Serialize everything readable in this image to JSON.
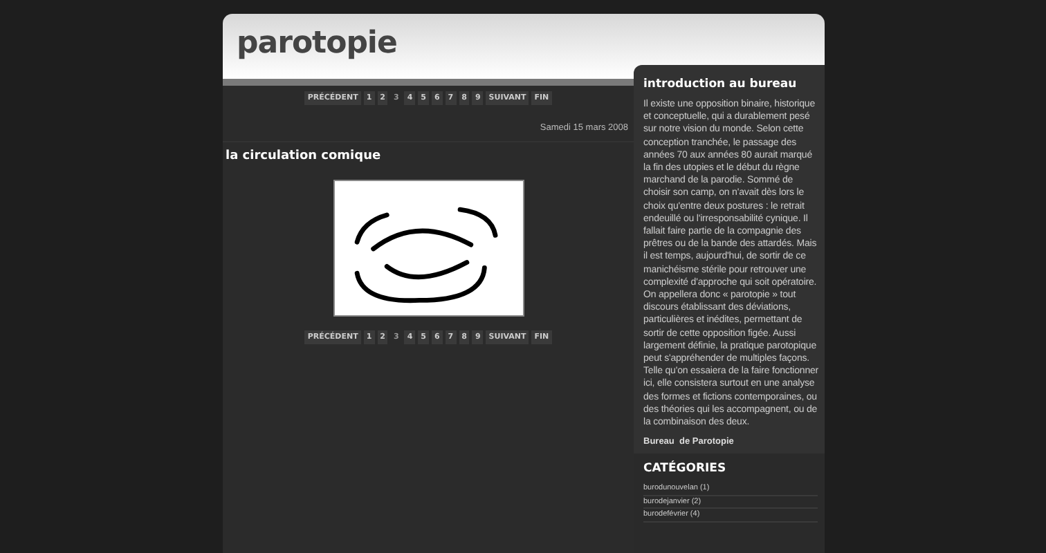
{
  "header": {
    "title": "parotopie"
  },
  "pagination_top": [
    {
      "label": "PRÉCÉDENT",
      "selected": false
    },
    {
      "label": "1",
      "selected": false
    },
    {
      "label": "2",
      "selected": false
    },
    {
      "label": "3",
      "selected": true
    },
    {
      "label": "4",
      "selected": false
    },
    {
      "label": "5",
      "selected": false
    },
    {
      "label": "6",
      "selected": false
    },
    {
      "label": "7",
      "selected": false
    },
    {
      "label": "8",
      "selected": false
    },
    {
      "label": "9",
      "selected": false
    },
    {
      "label": "SUIVANT",
      "selected": false
    },
    {
      "label": "FIN",
      "selected": false
    }
  ],
  "post": {
    "date": "Samedi 15 mars 2008",
    "title": "la circulation comique"
  },
  "pagination_bottom": [
    {
      "label": "PRÉCÉDENT",
      "selected": false
    },
    {
      "label": "1",
      "selected": false
    },
    {
      "label": "2",
      "selected": false
    },
    {
      "label": "3",
      "selected": true
    },
    {
      "label": "4",
      "selected": false
    },
    {
      "label": "5",
      "selected": false
    },
    {
      "label": "6",
      "selected": false
    },
    {
      "label": "7",
      "selected": false
    },
    {
      "label": "8",
      "selected": false
    },
    {
      "label": "9",
      "selected": false
    },
    {
      "label": "SUIVANT",
      "selected": false
    },
    {
      "label": "FIN",
      "selected": false
    }
  ],
  "sidebar": {
    "title": "introduction au bureau",
    "text": "Il existe une opposition binaire, historique et conceptuelle, qui a durablement pesé sur notre vision du monde. Selon cette conception tranchée, le passage des années 70 aux années 80 aurait marqué la fin des utopies et le début du règne marchand de la parodie. Sommé de choisir son camp, on n'avait dès lors le choix qu'entre deux postures : le retrait endeuillé ou l'irresponsabilité cynique. Il fallait faire partie de la compagnie des prêtres ou de la bande des attardés. Mais il est temps, aujourd'hui, de sortir de ce manichéisme stérile pour retrouver une complexité d'approche qui soit opératoire. On appellera donc « parotopie » tout discours établissant des déviations, particulières et inédites, permettant de sortir de cette opposition figée. Aussi largement définie, la pratique parotopique peut s'appréhender de multiples façons. Telle qu'on essaiera de la faire fonctionner ici, elle consistera surtout en une analyse des formes et fictions contemporaines, ou des théories qui les accompagnent, ou de la combinaison des deux.",
    "signature": "Bureau  de Parotopie"
  },
  "categories": {
    "title": "CATÉGORIES",
    "items": [
      "burodunouvelan (1)",
      "burodejanvier (2)",
      "burodefévrier (4)"
    ]
  }
}
